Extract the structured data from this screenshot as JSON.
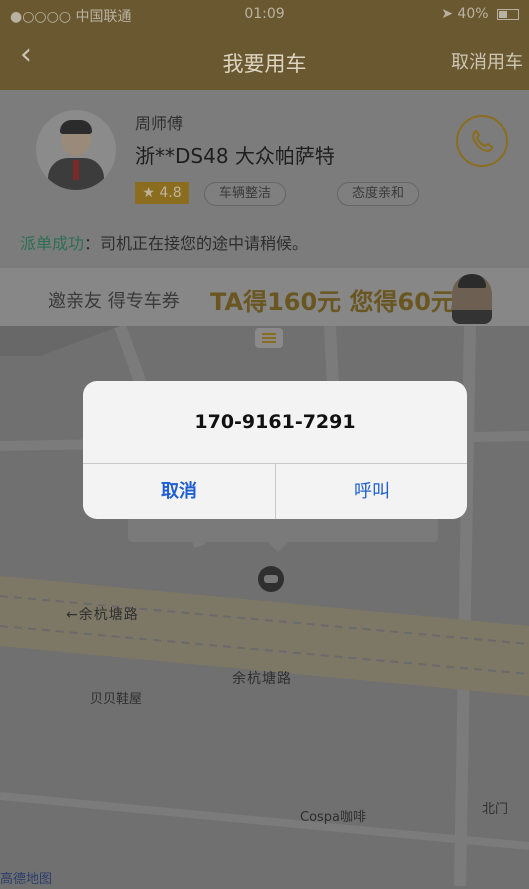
{
  "status_bar": {
    "carrier": "●○○○○ 中国联通",
    "time": "01:09",
    "battery": "40%"
  },
  "nav": {
    "back_icon": "chevron-left-icon",
    "title": "我要用车",
    "cancel": "取消用车"
  },
  "driver": {
    "name": "周师傅",
    "plate_car": "浙**DS48  大众帕萨特",
    "rating": "★ 4.8",
    "tags": [
      "车辆整洁",
      "态度亲和"
    ],
    "phone_icon": "phone-icon"
  },
  "dispatch": {
    "label": "派单成功",
    "message": "：司机正在接您的途中请稍候。"
  },
  "banner": {
    "text1": "邀亲友 得专车券",
    "text2": "TA得160元 您得60元"
  },
  "map": {
    "road1": "←余杭塘路",
    "road2": "余杭塘路",
    "poi1": "贝贝鞋屋",
    "poi2": "Cospa咖啡",
    "poi3": "北门",
    "logo": "高德地图"
  },
  "dialog": {
    "number": "170-9161-7291",
    "cancel": "取消",
    "call": "呼叫"
  }
}
